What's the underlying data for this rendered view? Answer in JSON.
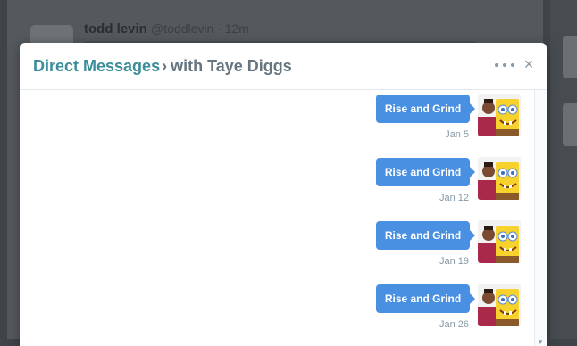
{
  "background": {
    "tweet_name": "todd levin",
    "tweet_handle": "@toddlevin · 12m"
  },
  "modal": {
    "title_link": "Direct Messages",
    "title_separator": "›",
    "title_rest": "with Taye Diggs",
    "more_icon": "more-dots-icon",
    "close_label": "×"
  },
  "messages": [
    {
      "text": "Rise and Grind",
      "date": "Jan 5"
    },
    {
      "text": "Rise and Grind",
      "date": "Jan 12"
    },
    {
      "text": "Rise and Grind",
      "date": "Jan 19"
    },
    {
      "text": "Rise and Grind",
      "date": "Jan 26"
    }
  ],
  "colors": {
    "accent": "#3b8d99",
    "bubble": "#4a90e2"
  }
}
